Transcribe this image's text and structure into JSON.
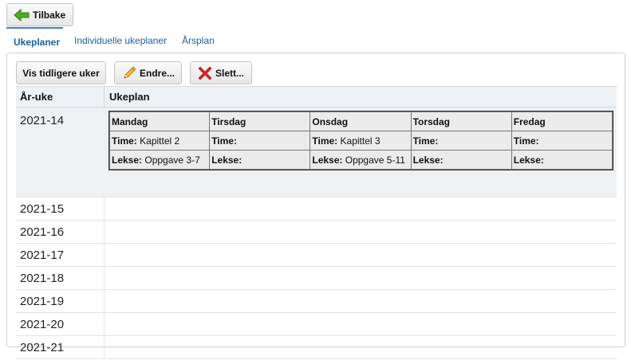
{
  "back_button": {
    "label": "Tilbake"
  },
  "tabs": [
    {
      "label": "Ukeplaner",
      "active": true
    },
    {
      "label": "Individuelle ukeplaner",
      "active": false
    },
    {
      "label": "Årsplan",
      "active": false
    }
  ],
  "toolbar": {
    "show_earlier_label": "Vis tidligere uker",
    "edit_label": "Endre...",
    "delete_label": "Slett..."
  },
  "grid": {
    "headers": {
      "week": "År-uke",
      "plan": "Ukeplan"
    },
    "weekly_plan": {
      "days": [
        "Mandag",
        "Tirsdag",
        "Onsdag",
        "Torsdag",
        "Fredag"
      ],
      "time_label": "Time:",
      "homework_label": "Lekse:",
      "times": [
        "Kapittel 2",
        "",
        "Kapittel 3",
        "",
        ""
      ],
      "homework": [
        "Oppgave 3-7",
        "",
        "Oppgave 5-11",
        "",
        ""
      ]
    },
    "weeks": [
      "2021-14",
      "2021-15",
      "2021-16",
      "2021-17",
      "2021-18",
      "2021-19",
      "2021-20",
      "2021-21"
    ]
  },
  "colors": {
    "accent": "#3a82c4",
    "link": "#1a5f9e",
    "back_arrow": "#4cae1f",
    "delete_x": "#e02424"
  }
}
